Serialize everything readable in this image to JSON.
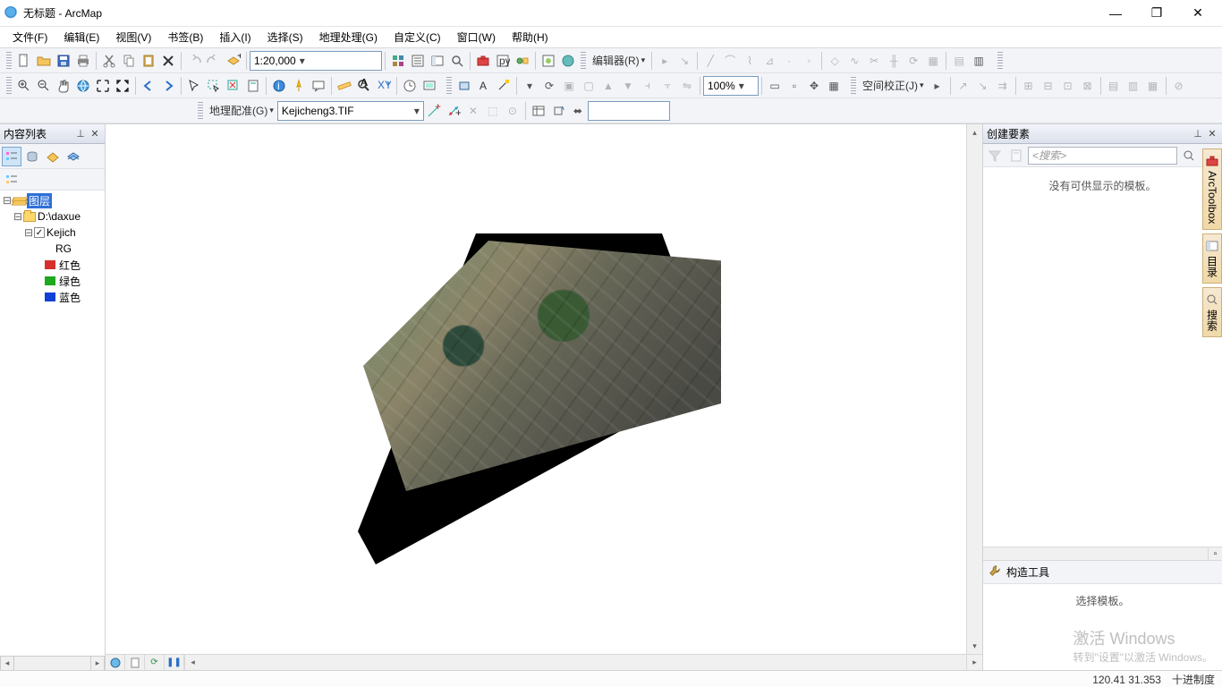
{
  "window": {
    "title": "无标题 - ArcMap"
  },
  "menu": {
    "file": "文件(F)",
    "edit": "编辑(E)",
    "view": "视图(V)",
    "bookmark": "书签(B)",
    "insert": "插入(I)",
    "select": "选择(S)",
    "geoproc": "地理处理(G)",
    "custom": "自定义(C)",
    "window": "窗口(W)",
    "help": "帮助(H)"
  },
  "toolbar": {
    "scale": "1:20,000",
    "editor_label": "编辑器(R)",
    "zoom_pct": "100%",
    "spatialadj_label": "空间校正(J)",
    "georef_label": "地理配准(G)",
    "georef_layer": "Kejicheng3.TIF",
    "georef_input": ""
  },
  "toc": {
    "title": "内容列表",
    "root": "图层",
    "folder": "D:\\daxue",
    "layer": "Kejich",
    "rgb_label": "RG",
    "bands": [
      {
        "color": "#d7302a",
        "label": "红色"
      },
      {
        "color": "#1ea81e",
        "label": "绿色"
      },
      {
        "color": "#1040d8",
        "label": "蓝色"
      }
    ]
  },
  "create_features": {
    "title": "创建要素",
    "search_placeholder": "<搜索>",
    "empty_msg": "没有可供显示的模板。",
    "section": "构造工具",
    "select_tpl": "选择模板。"
  },
  "side_tabs": {
    "toolbox": "ArcToolbox",
    "catalog": "目录",
    "search": "搜索"
  },
  "watermark": {
    "l1": "激活 Windows",
    "l2": "转到\"设置\"以激活 Windows。"
  },
  "status": {
    "coords": "120.41  31.353",
    "unit": "十进制度"
  }
}
